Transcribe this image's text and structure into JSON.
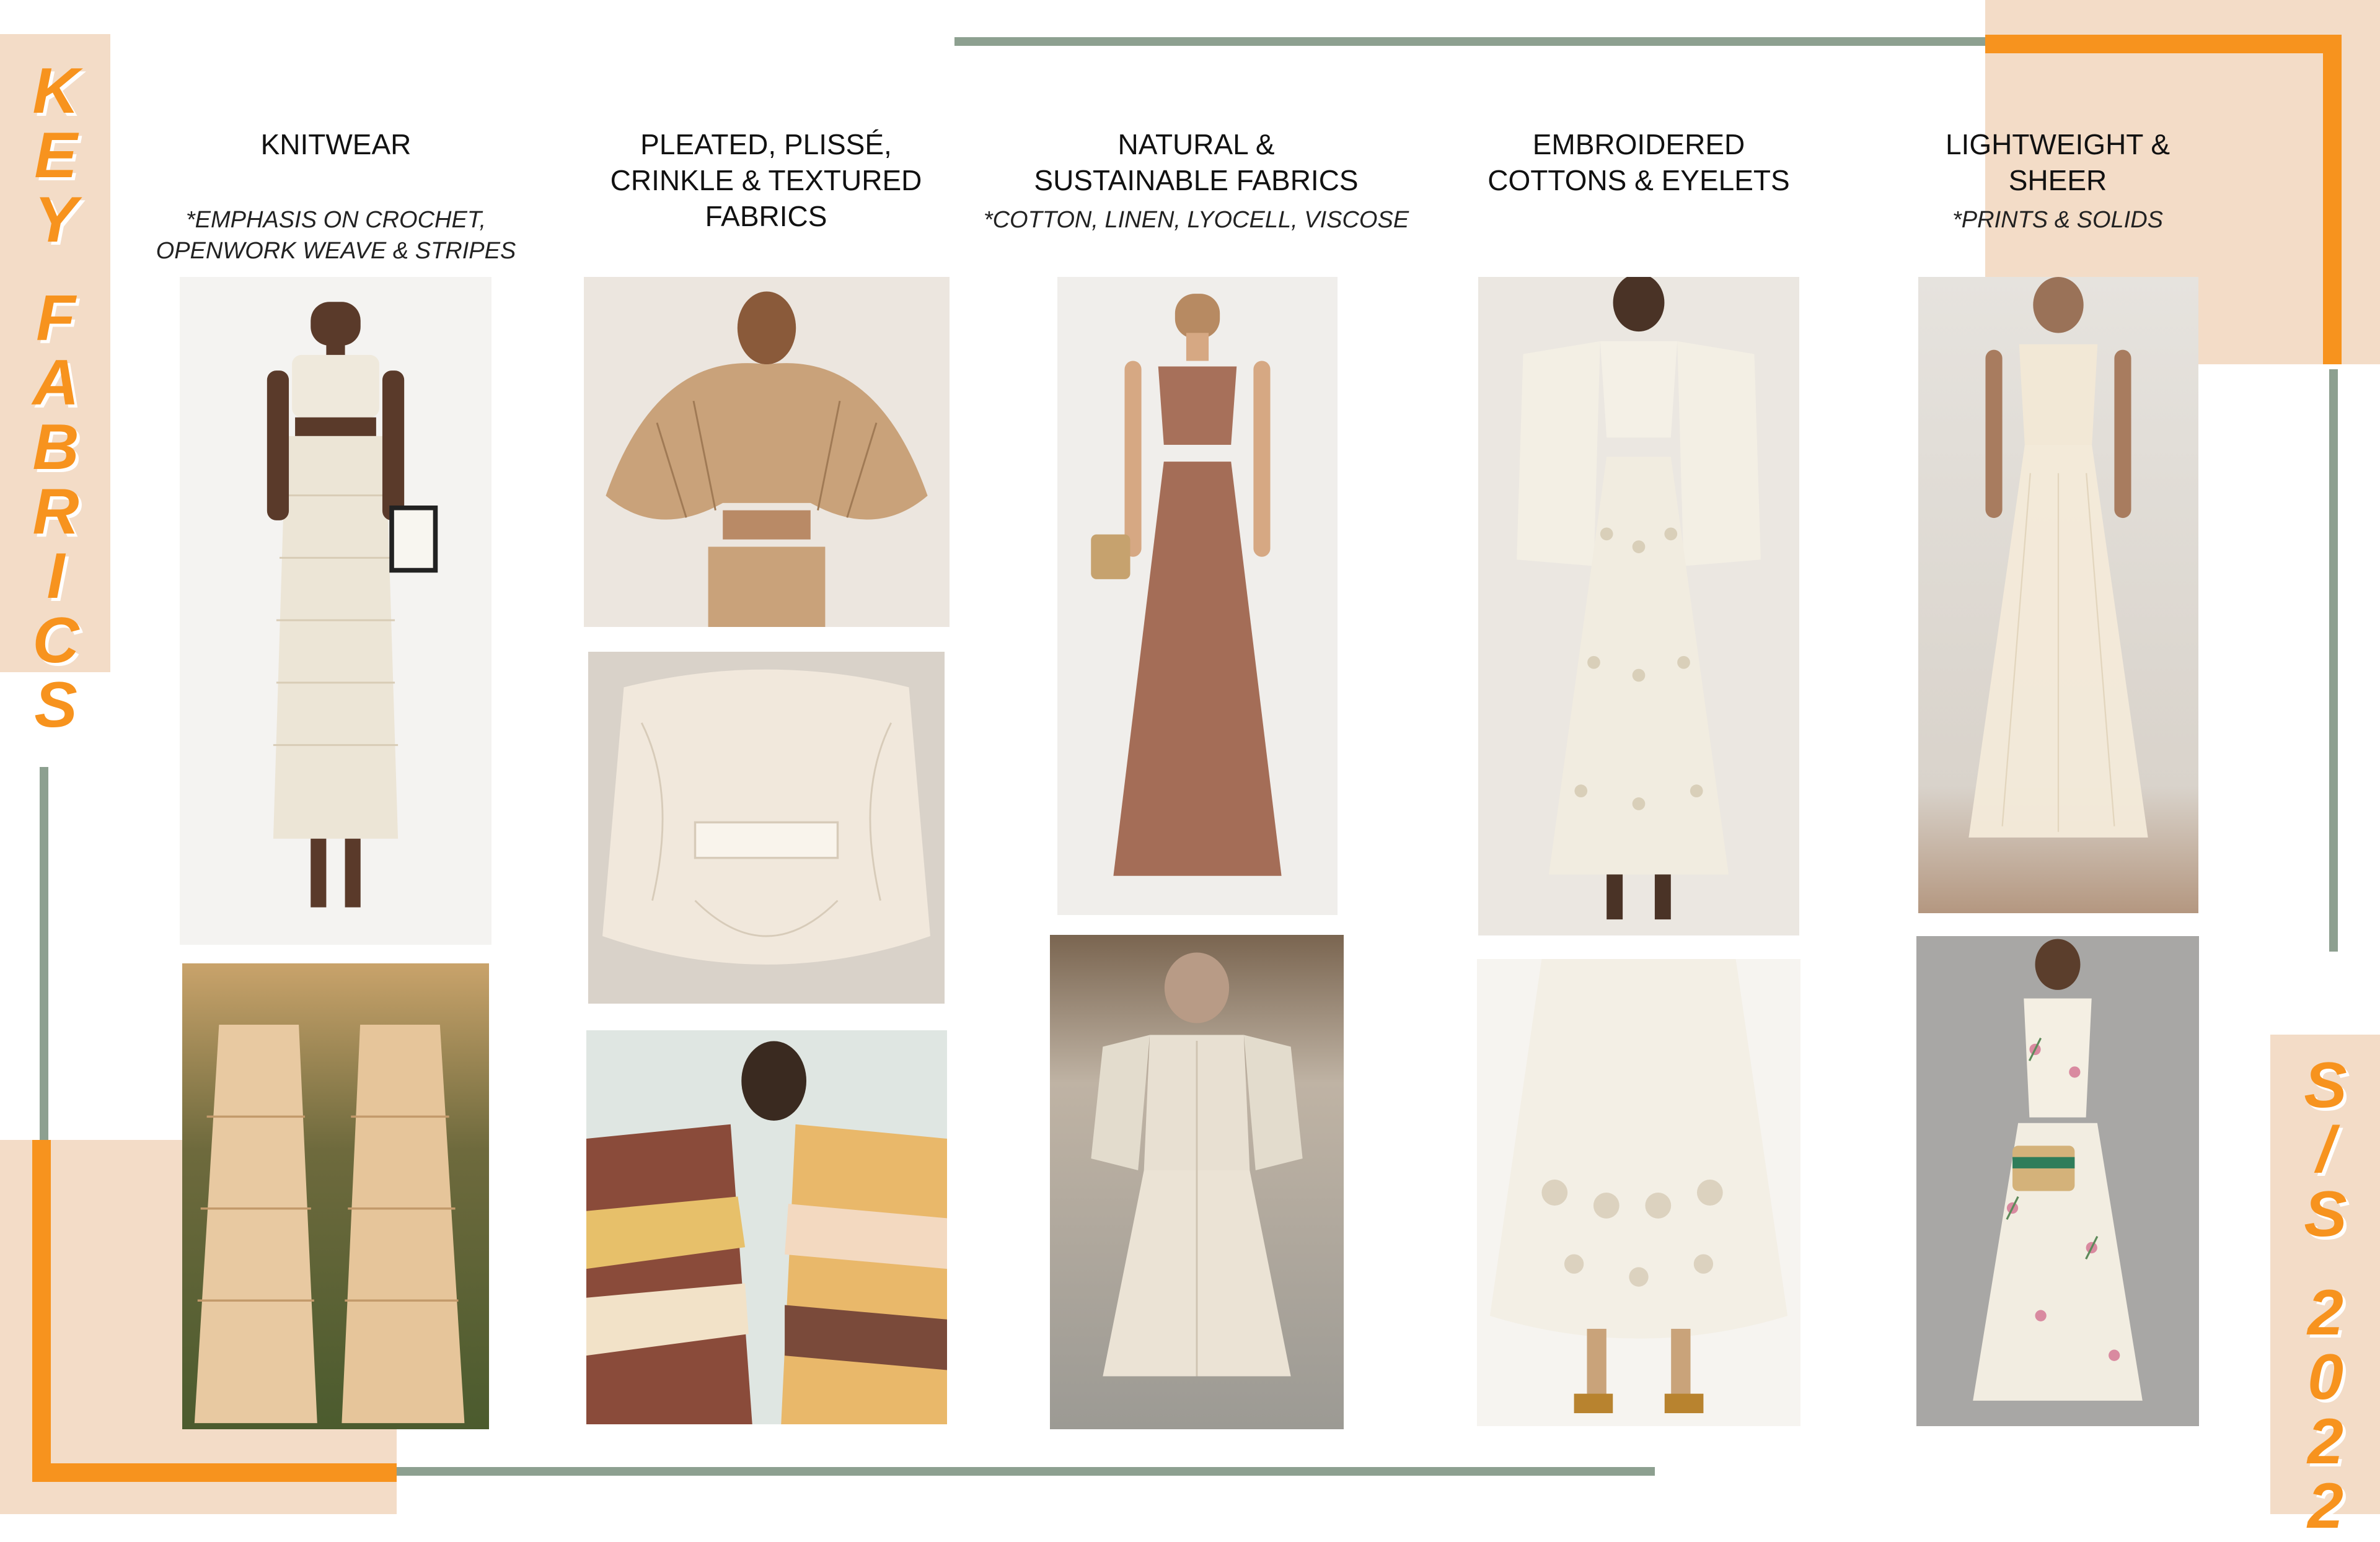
{
  "side_left": {
    "letters_line1": [
      "K",
      "E",
      "Y"
    ],
    "letters_line2": [
      "F",
      "A",
      "B",
      "R",
      "I",
      "C",
      "S"
    ]
  },
  "side_right": {
    "letters_line1": [
      "S",
      "/",
      "S"
    ],
    "letters_line2": [
      "2",
      "0",
      "2",
      "2"
    ]
  },
  "columns": [
    {
      "title_lines": [
        "KNITWEAR"
      ],
      "subtitle_lines": [
        "*EMPHASIS ON CROCHET,",
        "OPENWORK WEAVE & STRIPES"
      ]
    },
    {
      "title_lines": [
        "PLEATED, PLISSÉ,",
        "CRINKLE & TEXTURED",
        "FABRICS"
      ],
      "subtitle_lines": []
    },
    {
      "title_lines": [
        "NATURAL &",
        "SUSTAINABLE FABRICS"
      ],
      "subtitle_lines": [
        "*COTTON, LINEN, LYOCELL, VISCOSE"
      ]
    },
    {
      "title_lines": [
        "EMBROIDERED",
        "COTTONS & EYELETS"
      ],
      "subtitle_lines": []
    },
    {
      "title_lines": [
        "LIGHTWEIGHT &",
        "SHEER"
      ],
      "subtitle_lines": [
        "*PRINTS & SOLIDS"
      ]
    }
  ],
  "colors": {
    "accent": "#f7931e",
    "frame_beige": "#f3dcc7",
    "frame_sage": "#8da090"
  }
}
